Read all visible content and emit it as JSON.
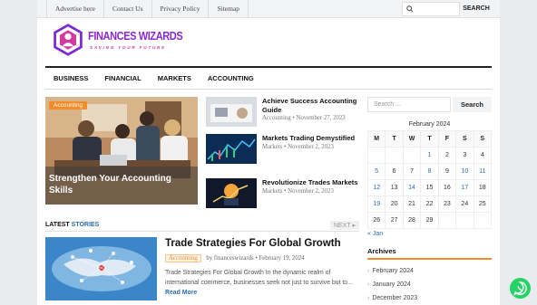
{
  "topbar": {
    "links": [
      "Advertise here",
      "Contact Us",
      "Privacy Policy",
      "Sitemap"
    ],
    "search_button": "SEARCH"
  },
  "logo": {
    "name": "FINANCES WIZARDS",
    "tagline": "SAVING YOUR FUTURE"
  },
  "nav": [
    "BUSINESS",
    "FINANCIAL",
    "MARKETS",
    "ACCOUNTING"
  ],
  "featured": {
    "category": "Accounting",
    "title": "Strengthen Your Accounting Skills"
  },
  "side_posts": [
    {
      "title": "Achieve Success Accounting Guide",
      "category": "Accounting",
      "date": "November 27, 2023"
    },
    {
      "title": "Markets Trading Demystified",
      "category": "Markets",
      "date": "November 2, 2023"
    },
    {
      "title": "Revolutionize Trades Markets",
      "category": "Markets",
      "date": "November 2, 2023"
    }
  ],
  "latest": {
    "label_a": "LATEST",
    "label_b": "STORIES",
    "next": "NEXT",
    "article": {
      "title": "Trade Strategies For Global Growth",
      "category": "Accounting",
      "author": "by financeswizards",
      "date": "February 19, 2024",
      "excerpt": "Trade Strategies For Global Growth In the dynamic realm of international commerce, businesses seek not just to survive but to...",
      "read_more": "Read More"
    }
  },
  "sidebar": {
    "search_placeholder": "Search ...",
    "search_button": "Search",
    "calendar": {
      "caption": "February 2024",
      "days": [
        "M",
        "T",
        "W",
        "T",
        "F",
        "S",
        "S"
      ],
      "rows": [
        [
          "",
          "",
          "",
          "1",
          "2",
          "3",
          "4"
        ],
        [
          "5",
          "6",
          "7",
          "8",
          "9",
          "10",
          "11"
        ],
        [
          "12",
          "13",
          "14",
          "15",
          "16",
          "17",
          "18"
        ],
        [
          "19",
          "20",
          "21",
          "22",
          "23",
          "24",
          "25"
        ],
        [
          "26",
          "27",
          "28",
          "29",
          "",
          "",
          ""
        ]
      ],
      "linked": [
        "1",
        "5",
        "8",
        "10",
        "11",
        "12",
        "14",
        "17",
        "19"
      ],
      "prev": "« Jan"
    },
    "archives_title": "Archives",
    "archives": [
      "February 2024",
      "January 2024",
      "December 2023"
    ]
  },
  "colors": {
    "accent": "#f28c28",
    "link": "#2c6db5",
    "logo": "#8b2ad1",
    "whatsapp": "#25d366"
  }
}
